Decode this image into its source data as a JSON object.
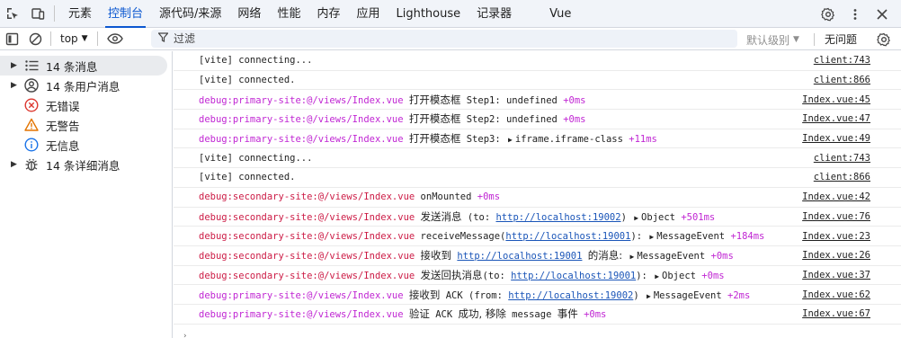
{
  "tabbar": {
    "tabs": [
      "元素",
      "控制台",
      "源代码/来源",
      "网络",
      "性能",
      "内存",
      "应用",
      "Lighthouse",
      "记录器",
      "Vue"
    ],
    "active_index": 1,
    "icons": [
      "inspect-icon",
      "device-toggle-icon",
      "gear-icon",
      "more-vert-icon",
      "close-icon"
    ]
  },
  "toolbar": {
    "context": "top",
    "filter_placeholder": "过滤",
    "levels": "默认级别",
    "issues": "无问题"
  },
  "sidebar": {
    "items": [
      {
        "label": "14 条消息",
        "icon": "list-icon",
        "expandable": true,
        "selected": true
      },
      {
        "label": "14 条用户消息",
        "icon": "user-icon",
        "expandable": true,
        "selected": false
      },
      {
        "label": "无错误",
        "icon": "error-icon",
        "expandable": false,
        "selected": false
      },
      {
        "label": "无警告",
        "icon": "warning-icon",
        "expandable": false,
        "selected": false
      },
      {
        "label": "无信息",
        "icon": "info-icon",
        "expandable": false,
        "selected": false
      },
      {
        "label": "14 条详细消息",
        "icon": "bug-icon",
        "expandable": true,
        "selected": false
      }
    ]
  },
  "colors": {
    "accent": "#0b57d0",
    "primary_ns": "#c026d3",
    "secondary_ns": "#cc1b45",
    "error": "#dc362e",
    "warning": "#e37400",
    "info": "#1a73e8"
  },
  "log": [
    {
      "parts": [
        {
          "t": "[vite] connecting..."
        }
      ],
      "src": "client:743"
    },
    {
      "parts": [
        {
          "t": "[vite] connected."
        }
      ],
      "src": "client:866"
    },
    {
      "parts": [
        {
          "t": "debug:primary-site:@/views/Index.vue ",
          "c": "ns-primary"
        },
        {
          "t": "打开模态框",
          "c": "cjk"
        },
        {
          "t": " Step1: undefined "
        },
        {
          "t": "+0ms",
          "c": "delta"
        }
      ],
      "src": "Index.vue:45"
    },
    {
      "parts": [
        {
          "t": "debug:primary-site:@/views/Index.vue ",
          "c": "ns-primary"
        },
        {
          "t": "打开模态框",
          "c": "cjk"
        },
        {
          "t": " Step2: undefined "
        },
        {
          "t": "+0ms",
          "c": "delta"
        }
      ],
      "src": "Index.vue:47"
    },
    {
      "parts": [
        {
          "t": "debug:primary-site:@/views/Index.vue ",
          "c": "ns-primary"
        },
        {
          "t": "打开模态框",
          "c": "cjk"
        },
        {
          "t": " Step3: "
        },
        {
          "t": "▶",
          "c": "tri"
        },
        {
          "t": "iframe.iframe-class "
        },
        {
          "t": "+11ms",
          "c": "delta"
        }
      ],
      "src": "Index.vue:49"
    },
    {
      "parts": [
        {
          "t": "[vite] connecting..."
        }
      ],
      "src": "client:743"
    },
    {
      "parts": [
        {
          "t": "[vite] connected."
        }
      ],
      "src": "client:866"
    },
    {
      "parts": [
        {
          "t": "debug:secondary-site:@/views/Index.vue ",
          "c": "ns-secondary"
        },
        {
          "t": "onMounted "
        },
        {
          "t": "+0ms",
          "c": "delta"
        }
      ],
      "src": "Index.vue:42"
    },
    {
      "parts": [
        {
          "t": "debug:secondary-site:@/views/Index.vue ",
          "c": "ns-secondary"
        },
        {
          "t": "发送消息",
          "c": "cjk"
        },
        {
          "t": " (to: "
        },
        {
          "t": "http://localhost:19002",
          "c": "lnk"
        },
        {
          "t": ") "
        },
        {
          "t": "▶",
          "c": "tri"
        },
        {
          "t": "Object "
        },
        {
          "t": "+501ms",
          "c": "delta"
        }
      ],
      "src": "Index.vue:76"
    },
    {
      "parts": [
        {
          "t": "debug:secondary-site:@/views/Index.vue ",
          "c": "ns-secondary"
        },
        {
          "t": "receiveMessage("
        },
        {
          "t": "http://localhost:19001",
          "c": "lnk"
        },
        {
          "t": "): "
        },
        {
          "t": "▶",
          "c": "tri"
        },
        {
          "t": "MessageEvent "
        },
        {
          "t": "+184ms",
          "c": "delta"
        }
      ],
      "src": "Index.vue:23"
    },
    {
      "parts": [
        {
          "t": "debug:secondary-site:@/views/Index.vue ",
          "c": "ns-secondary"
        },
        {
          "t": "接收到",
          "c": "cjk"
        },
        {
          "t": " "
        },
        {
          "t": "http://localhost:19001",
          "c": "lnk"
        },
        {
          "t": " "
        },
        {
          "t": "的消息:",
          "c": "cjk"
        },
        {
          "t": " "
        },
        {
          "t": "▶",
          "c": "tri"
        },
        {
          "t": "MessageEvent "
        },
        {
          "t": "+0ms",
          "c": "delta"
        }
      ],
      "src": "Index.vue:26"
    },
    {
      "parts": [
        {
          "t": "debug:secondary-site:@/views/Index.vue ",
          "c": "ns-secondary"
        },
        {
          "t": "发送回执消息",
          "c": "cjk"
        },
        {
          "t": "(to: "
        },
        {
          "t": "http://localhost:19001",
          "c": "lnk"
        },
        {
          "t": "): "
        },
        {
          "t": "▶",
          "c": "tri"
        },
        {
          "t": "Object "
        },
        {
          "t": "+0ms",
          "c": "delta"
        }
      ],
      "src": "Index.vue:37"
    },
    {
      "parts": [
        {
          "t": "debug:primary-site:@/views/Index.vue ",
          "c": "ns-primary"
        },
        {
          "t": "接收到",
          "c": "cjk"
        },
        {
          "t": " ACK (from: "
        },
        {
          "t": "http://localhost:19002",
          "c": "lnk"
        },
        {
          "t": ") "
        },
        {
          "t": "▶",
          "c": "tri"
        },
        {
          "t": "MessageEvent "
        },
        {
          "t": "+2ms",
          "c": "delta"
        }
      ],
      "src": "Index.vue:62"
    },
    {
      "parts": [
        {
          "t": "debug:primary-site:@/views/Index.vue ",
          "c": "ns-primary"
        },
        {
          "t": "验证",
          "c": "cjk"
        },
        {
          "t": " ACK "
        },
        {
          "t": "成功, 移除",
          "c": "cjk"
        },
        {
          "t": " message "
        },
        {
          "t": "事件",
          "c": "cjk"
        },
        {
          "t": " "
        },
        {
          "t": "+0ms",
          "c": "delta"
        }
      ],
      "src": "Index.vue:67"
    }
  ]
}
